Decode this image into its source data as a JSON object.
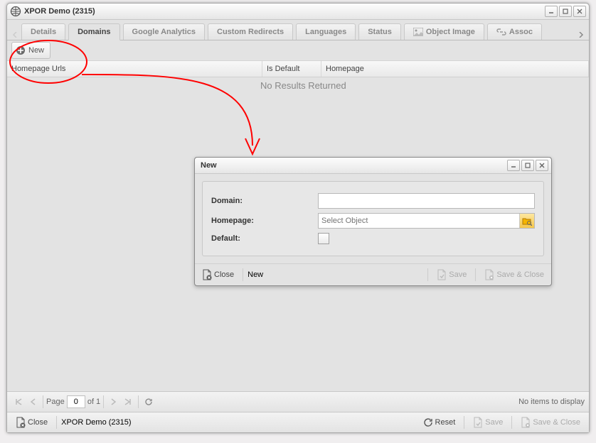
{
  "window": {
    "title": "XPOR Demo (2315)"
  },
  "tabs": {
    "details": "Details",
    "domains": "Domains",
    "google_analytics": "Google Analytics",
    "custom_redirects": "Custom Redirects",
    "languages": "Languages",
    "status": "Status",
    "object_image": "Object Image",
    "assoc": "Assoc"
  },
  "toolbar": {
    "new_label": "New"
  },
  "grid": {
    "columns": {
      "homepage_urls": "Homepage Urls",
      "is_default": "Is Default",
      "homepage": "Homepage"
    },
    "no_results": "No Results Returned"
  },
  "pager": {
    "page_label": "Page",
    "page_value": "0",
    "of_label": "of 1",
    "no_items": "No items to display"
  },
  "footer": {
    "close": "Close",
    "breadcrumb": "XPOR Demo (2315)",
    "reset": "Reset",
    "save": "Save",
    "save_close": "Save & Close"
  },
  "dialog": {
    "title": "New",
    "fields": {
      "domain": "Domain:",
      "homepage": "Homepage:",
      "default": "Default:"
    },
    "homepage_placeholder": "Select Object",
    "footer": {
      "close": "Close",
      "mode": "New",
      "save": "Save",
      "save_close": "Save & Close"
    }
  }
}
